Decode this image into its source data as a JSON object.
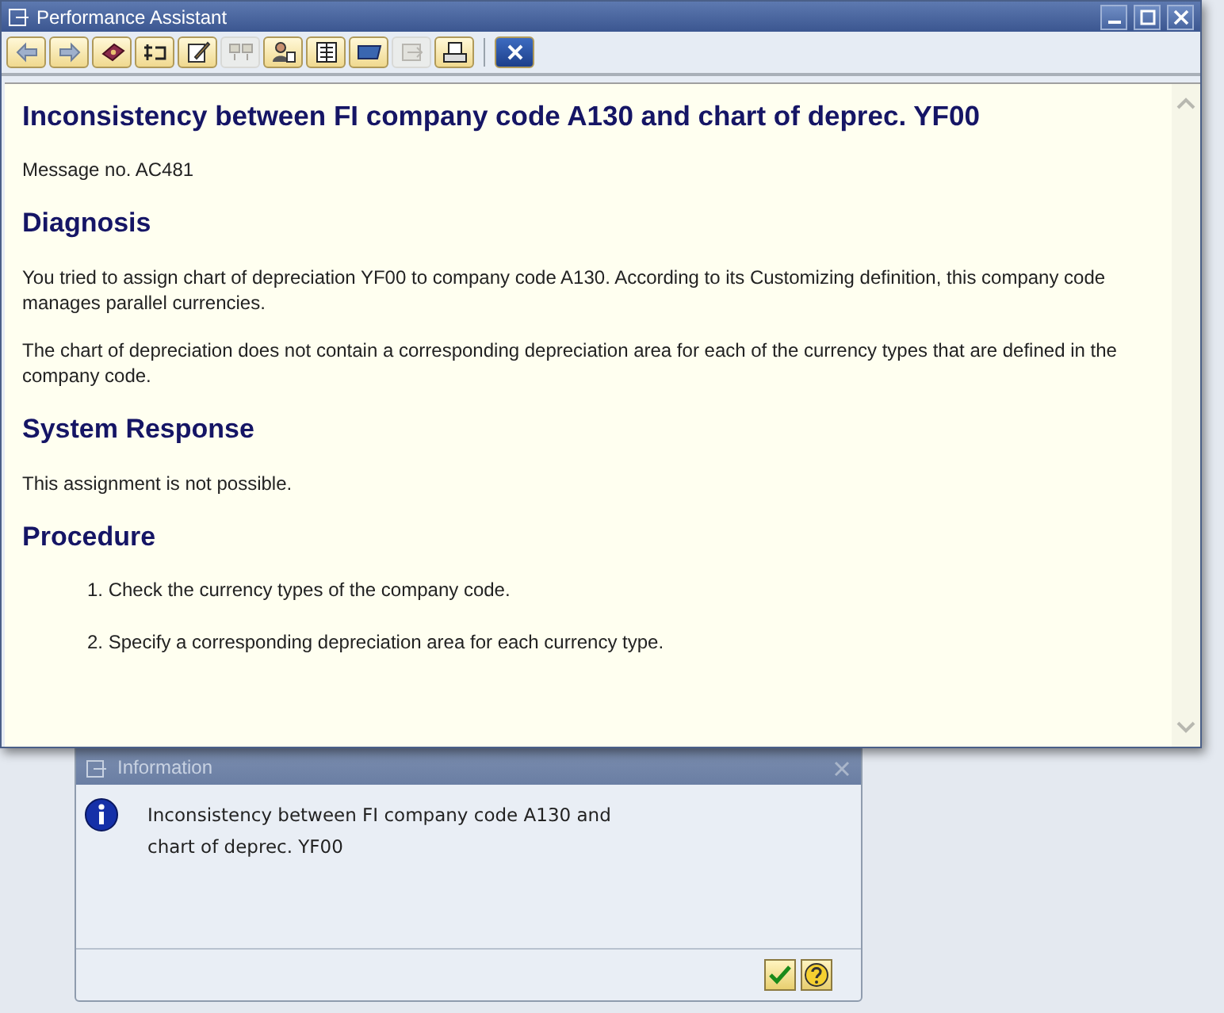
{
  "window": {
    "title": "Performance Assistant"
  },
  "toolbar": [
    {
      "kind": "back",
      "disabled": false
    },
    {
      "kind": "forward",
      "disabled": false
    },
    {
      "kind": "book",
      "disabled": false
    },
    {
      "kind": "structure",
      "disabled": false
    },
    {
      "kind": "edit",
      "disabled": false
    },
    {
      "kind": "compare",
      "disabled": true
    },
    {
      "kind": "user",
      "disabled": false
    },
    {
      "kind": "list",
      "disabled": false
    },
    {
      "kind": "folder",
      "disabled": false
    },
    {
      "kind": "export",
      "disabled": true
    },
    {
      "kind": "print",
      "disabled": false
    },
    {
      "kind": "separator"
    },
    {
      "kind": "close",
      "disabled": false
    }
  ],
  "document": {
    "title": "Inconsistency between FI company code A130 and chart of deprec. YF00",
    "message_no": "Message no. AC481",
    "sections": [
      {
        "heading": "Diagnosis",
        "paragraphs": [
          "You tried to assign chart of depreciation YF00 to company code A130. According to its Customizing definition, this company code manages parallel currencies.",
          "The chart of depreciation does not contain a corresponding depreciation area for each of the currency types that are defined in the company code."
        ]
      },
      {
        "heading": "System Response",
        "paragraphs": [
          "This assignment is not possible."
        ]
      },
      {
        "heading": "Procedure",
        "steps": [
          "1. Check the currency types of the company code.",
          "2. Specify a corresponding depreciation area for each currency type."
        ]
      }
    ]
  },
  "info_dialog": {
    "title": "Information",
    "message_lines": [
      "Inconsistency between FI company code A130 and",
      "chart of deprec. YF00"
    ]
  }
}
